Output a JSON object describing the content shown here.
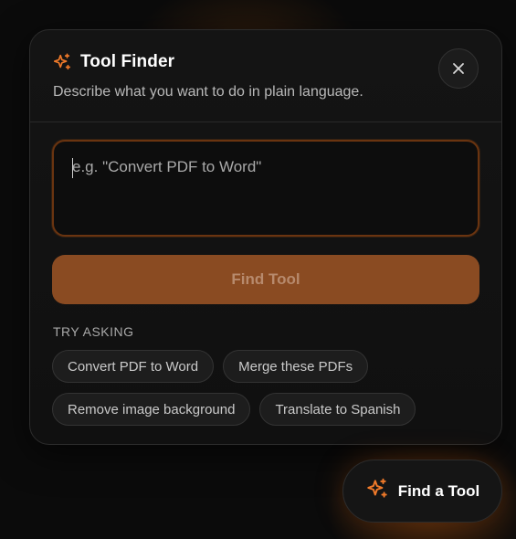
{
  "colors": {
    "accent": "#f07a2a",
    "button_bg": "#8a4b22",
    "panel_bg": "#121212"
  },
  "dialog": {
    "title": "Tool Finder",
    "title_icon": "sparkle-icon",
    "subtitle": "Describe what you want to do in plain language.",
    "close_icon": "close-icon"
  },
  "query": {
    "value": "",
    "placeholder": "e.g. \"Convert PDF to Word\""
  },
  "find_button": {
    "label": "Find Tool"
  },
  "suggestions": {
    "heading": "TRY ASKING",
    "items": [
      "Convert PDF to Word",
      "Merge these PDFs",
      "Remove image background",
      "Translate to Spanish"
    ]
  },
  "fab": {
    "label": "Find a Tool",
    "icon": "sparkle-icon"
  }
}
